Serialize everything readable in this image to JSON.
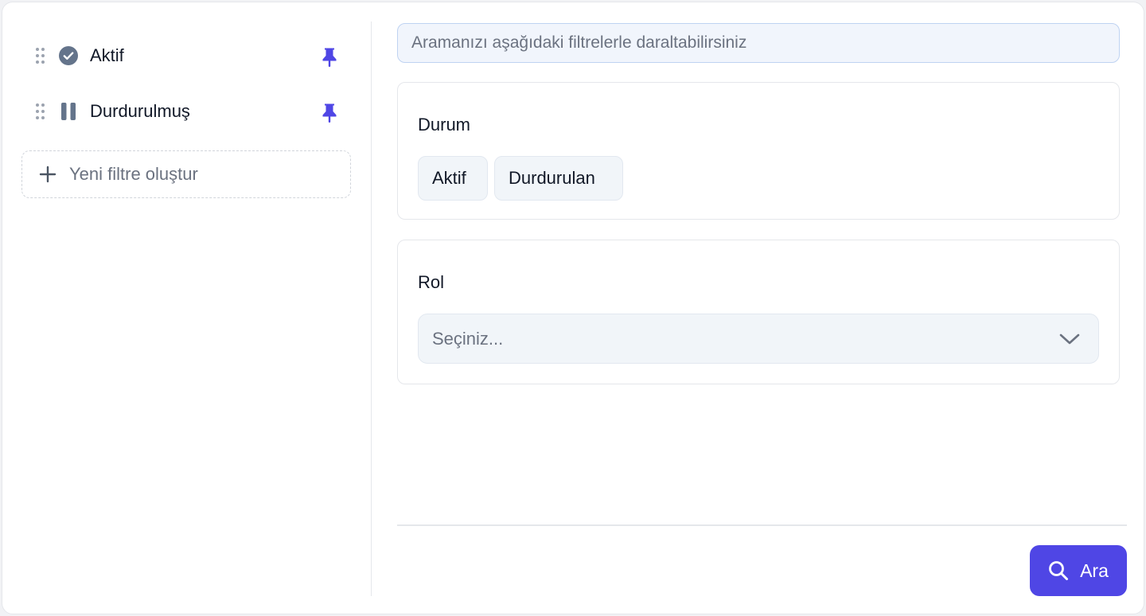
{
  "sidebar": {
    "saved_filters": [
      {
        "label": "Aktif",
        "icon": "check-circle-icon",
        "pin_icon": "pin-icon"
      },
      {
        "label": "Durdurulmuş",
        "icon": "pause-icon",
        "pin_icon": "pin-icon"
      }
    ],
    "new_filter_label": "Yeni filtre oluştur"
  },
  "search": {
    "placeholder": "Aramanızı aşağıdaki filtrelerle daraltabilirsiniz",
    "value": ""
  },
  "filters": {
    "status": {
      "title": "Durum",
      "options": [
        "Aktif",
        "Durdurulan"
      ]
    },
    "role": {
      "title": "Rol",
      "selected": "Seçiniz..."
    }
  },
  "actions": {
    "search_label": "Ara"
  },
  "colors": {
    "accent": "#4f46e5",
    "pin": "#4f46e5",
    "icon_slate": "#64748b",
    "input_bg": "#f1f5fc",
    "input_border": "#bfd3f2"
  }
}
